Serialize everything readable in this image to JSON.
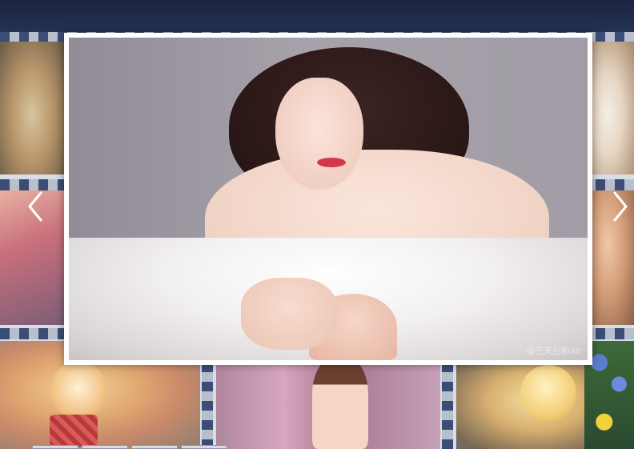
{
  "lightbox": {
    "watermark": "@三天后Blair"
  },
  "navigation": {
    "prev_icon": "chevron-left-icon",
    "next_icon": "chevron-right-icon"
  },
  "gallery": {
    "thumbnails": [
      {
        "subject": "dog-1"
      },
      {
        "subject": "right-top"
      },
      {
        "subject": "left-middle"
      },
      {
        "subject": "right-middle"
      },
      {
        "subject": "pomeranian"
      },
      {
        "subject": "woman"
      },
      {
        "subject": "chick"
      }
    ],
    "bottom_tab_count": 4
  },
  "colors": {
    "header": "#1a2440",
    "stripe_dark": "#3b4d74",
    "stripe_light": "#b7bfcd",
    "lightbox_border": "#ffffff"
  }
}
